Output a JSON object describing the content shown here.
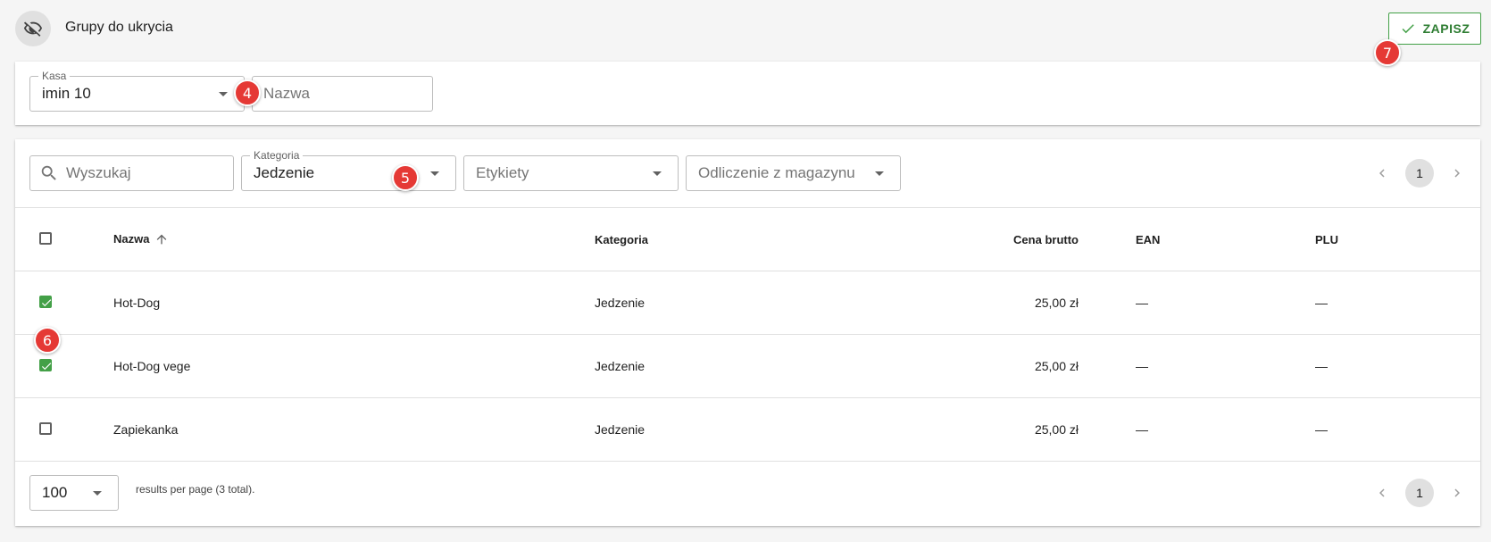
{
  "header": {
    "title": "Grupy do ukrycia",
    "icon": "eye-off-icon",
    "save_label": "ZAPISZ"
  },
  "filters_top": {
    "kasa_label": "Kasa",
    "kasa_value": "imin 10",
    "nazwa_placeholder": "Nazwa"
  },
  "filters_table": {
    "search_placeholder": "Wyszukaj",
    "kategoria_label": "Kategoria",
    "kategoria_value": "Jedzenie",
    "etykiety_placeholder": "Etykiety",
    "odliczenie_placeholder": "Odliczenie z magazynu"
  },
  "pagination": {
    "page": "1"
  },
  "table": {
    "columns": {
      "nazwa": "Nazwa",
      "kategoria": "Kategoria",
      "cena": "Cena brutto",
      "ean": "EAN",
      "plu": "PLU"
    },
    "rows": [
      {
        "checked": true,
        "nazwa": "Hot-Dog",
        "kategoria": "Jedzenie",
        "cena": "25,00 zł",
        "ean": "—",
        "plu": "—"
      },
      {
        "checked": true,
        "nazwa": "Hot-Dog vege",
        "kategoria": "Jedzenie",
        "cena": "25,00 zł",
        "ean": "—",
        "plu": "—"
      },
      {
        "checked": false,
        "nazwa": "Zapiekanka",
        "kategoria": "Jedzenie",
        "cena": "25,00 zł",
        "ean": "—",
        "plu": "—"
      }
    ]
  },
  "footer": {
    "per_page": "100",
    "results_text": "results per page (3 total)."
  },
  "badges": {
    "b4": "4",
    "b5": "5",
    "b6": "6",
    "b7": "7"
  },
  "colors": {
    "accent_green": "#43a047",
    "badge_red": "#e53935"
  }
}
